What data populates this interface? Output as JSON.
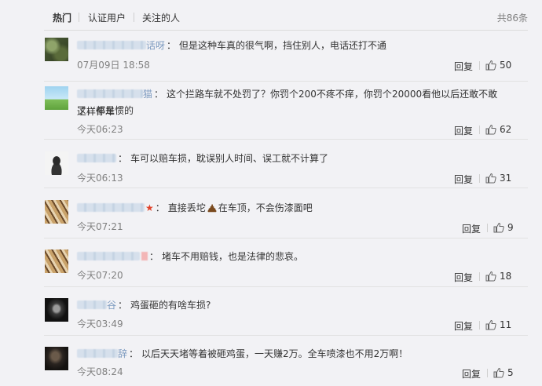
{
  "tabs": [
    {
      "label": "热门",
      "active": true
    },
    {
      "label": "认证用户",
      "active": false
    },
    {
      "label": "关注的人",
      "active": false
    }
  ],
  "total": "共86条",
  "colors": {
    "username": "#eb7350",
    "accent_star": "#e0432b",
    "meta_gray": "#808080"
  },
  "comments": [
    {
      "name_tail": "话呀",
      "text": "但是这种车真的很气啊，挡住别人，电话还打不通",
      "time": "07月09日 18:58",
      "reply": "回复",
      "likes": "50",
      "avatar": "avatar-green-foliage"
    },
    {
      "name_tail": "猫",
      "text": "这个拦路车就不处罚了？你罚个200不疼不痒，你罚个20000看他以后还敢不敢这样停车",
      "text2": "了，都是惯的",
      "time": "今天06:23",
      "reply": "回复",
      "likes": "62",
      "avatar": "avatar-sky-blue"
    },
    {
      "name_tail": "",
      "text": "车可以赔车损，耽误别人时间、误工就不计算了",
      "time": "今天06:13",
      "reply": "回复",
      "likes": "31",
      "avatar": "avatar-white-portrait"
    },
    {
      "name_tail": "",
      "text_pre": "直接丢坨",
      "emoji": "poop-emoji",
      "text_post": "在车顶，不会伤漆面吧",
      "time": "今天07:21",
      "reply": "回复",
      "likes": "9",
      "avatar": "avatar-tiger"
    },
    {
      "name_tail": "",
      "text": "堵车不用赔钱，也是法律的悲哀。",
      "time": "今天07:20",
      "reply": "回复",
      "likes": "18",
      "avatar": "avatar-tiger"
    },
    {
      "name_tail": "谷",
      "text": "鸡蛋砸的有啥车损?",
      "time": "今天03:49",
      "reply": "回复",
      "likes": "11",
      "avatar": "avatar-dark-portrait"
    },
    {
      "name_tail": "辞",
      "text": "以后天天堵等着被砸鸡蛋，一天赚2万。全车喷漆也不用2万啊！",
      "time": "今天08:24",
      "reply": "回复",
      "likes": "5",
      "avatar": "avatar-dark-person"
    }
  ]
}
